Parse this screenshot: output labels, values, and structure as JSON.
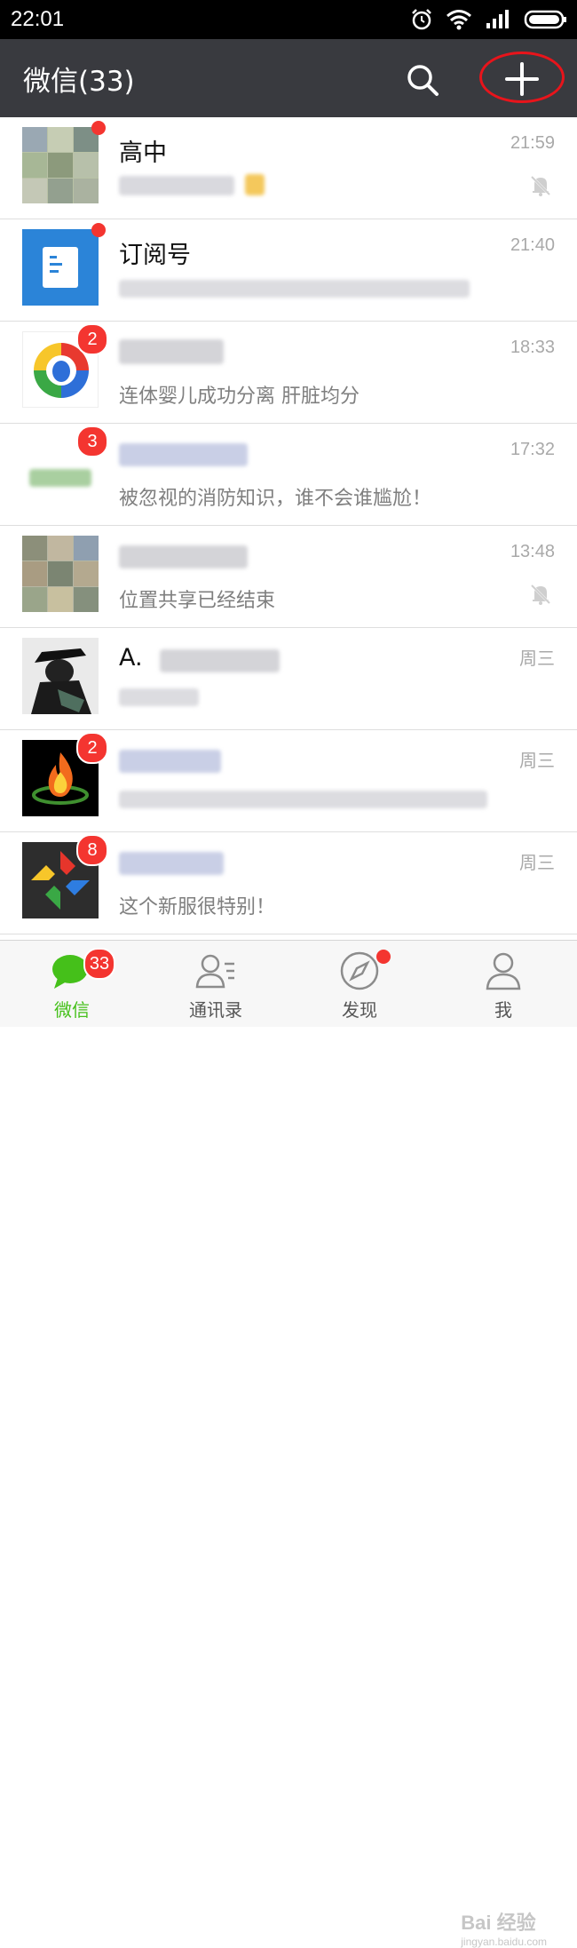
{
  "status_bar": {
    "time": "22:01"
  },
  "header": {
    "title": "微信(33)"
  },
  "chats": [
    {
      "name": "高中",
      "message": "",
      "time": "21:59",
      "muted": true,
      "unread": null,
      "dot": true,
      "avatar": "group-collage"
    },
    {
      "name": "订阅号",
      "message": "",
      "time": "21:40",
      "muted": false,
      "unread": null,
      "dot": true,
      "avatar": "subscription"
    },
    {
      "name": "",
      "message": "连体婴儿成功分离 肝脏均分",
      "time": "18:33",
      "muted": false,
      "unread": "2",
      "dot": false,
      "avatar": "tencent-news"
    },
    {
      "name": "",
      "message": "被忽视的消防知识，谁不会谁尴尬！",
      "time": "17:32",
      "muted": false,
      "unread": "3",
      "dot": false,
      "avatar": "green-blur"
    },
    {
      "name": "",
      "message": "位置共享已经结束",
      "time": "13:48",
      "muted": true,
      "unread": null,
      "dot": false,
      "avatar": "group-collage-2"
    },
    {
      "name": "A.",
      "message": "",
      "time": "周三",
      "muted": false,
      "unread": null,
      "dot": false,
      "avatar": "man-hat"
    },
    {
      "name": "",
      "message": "",
      "time": "周三",
      "muted": false,
      "unread": "2",
      "dot": false,
      "avatar": "fire"
    },
    {
      "name": "",
      "message": "这个新服很特别！",
      "time": "周三",
      "muted": false,
      "unread": "8",
      "dot": false,
      "avatar": "game-logo"
    }
  ],
  "tabs": [
    {
      "label": "微信",
      "badge": "33",
      "active": true
    },
    {
      "label": "通讯录",
      "badge": null,
      "active": false
    },
    {
      "label": "发现",
      "badge": null,
      "dot": true,
      "active": false
    },
    {
      "label": "我",
      "badge": null,
      "active": false
    }
  ],
  "watermark": {
    "line1": "Bai 经验",
    "line2": "jingyan.baidu.com"
  },
  "colors": {
    "brand_green": "#45c01a",
    "header_bg": "#393a3f",
    "badge_red": "#f43530",
    "highlight_circle": "#e8141b"
  }
}
